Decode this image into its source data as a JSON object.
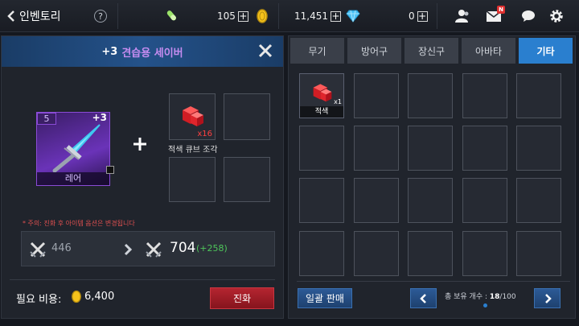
{
  "header": {
    "back_label": "인벤토리",
    "help": "?",
    "energy": "105",
    "gold": "11,451",
    "gems": "0",
    "plus": "+",
    "mail_badge": "N"
  },
  "upgrade": {
    "title_level": "+3",
    "title_name": "견습용 세이버",
    "item_level": "5",
    "item_enhance": "+3",
    "item_rarity": "레어",
    "material_count": "x16",
    "material_name": "적색 큐브 조각",
    "warning": "* 주의: 진화 후 아이템 옵션은 변경됩니다",
    "stat_before": "446",
    "stat_after": "704",
    "stat_delta": "(+258)",
    "cost_label": "필요 비용:",
    "cost_value": "6,400",
    "evolve_button": "진화"
  },
  "inventory": {
    "tabs": [
      "무기",
      "방어구",
      "장신구",
      "아바타",
      "기타"
    ],
    "active_tab": 4,
    "first_item_label": "적색",
    "first_item_count": "x1",
    "sell_all_button": "일괄 판매",
    "capacity_label": "총 보유 개수 :",
    "capacity_current": "18",
    "capacity_max": "/100"
  },
  "colors": {
    "accent_blue": "#2a7fcf",
    "rare_purple": "#8a4bd6",
    "evolve_red": "#a3202b",
    "title_name": "#c58cf0",
    "warning_red": "#e05050",
    "delta_green": "#4ec65a"
  }
}
